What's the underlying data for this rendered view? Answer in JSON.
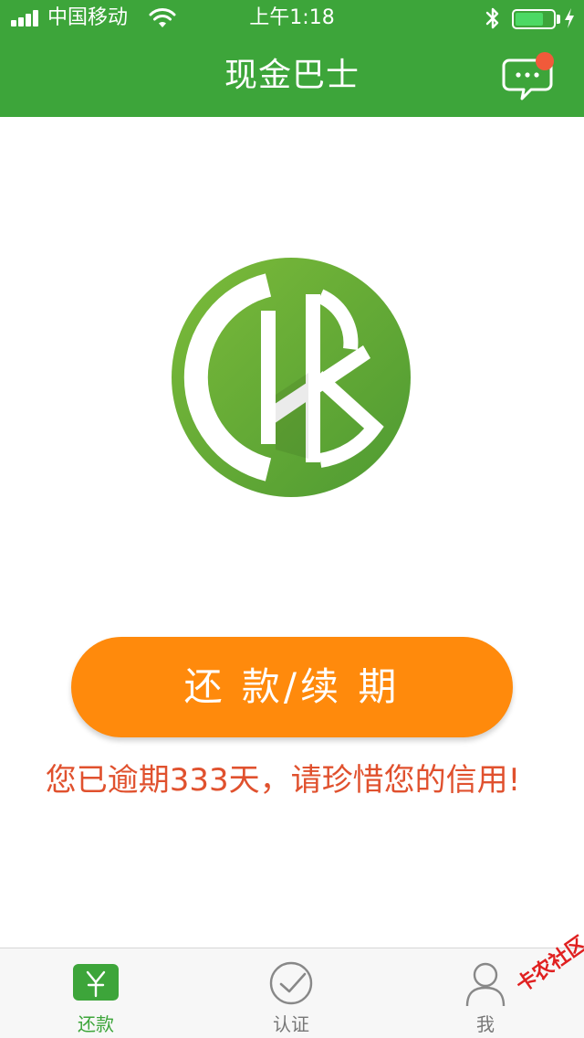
{
  "status_bar": {
    "carrier": "中国移动",
    "time": "上午1:18",
    "battery_level": 0.75,
    "icons": [
      "signal-icon",
      "wifi-icon",
      "bluetooth-icon",
      "battery-icon",
      "charging-icon"
    ]
  },
  "nav": {
    "title": "现金巴士",
    "message_icon": "chat-bubble-icon",
    "has_unread_badge": true
  },
  "main": {
    "logo": "cashbus-logo",
    "repay_button_label": "还 款/续 期",
    "overdue_notice": "您已逾期333天，请珍惜您的信用!"
  },
  "tabbar": {
    "tabs": [
      {
        "label": "还款",
        "icon": "yen-icon",
        "active": true
      },
      {
        "label": "认证",
        "icon": "check-circle-icon",
        "active": false
      },
      {
        "label": "我",
        "icon": "person-icon",
        "active": false
      }
    ]
  },
  "watermark": {
    "text": "卡农社区"
  },
  "colors": {
    "brand_green": "#3da53a",
    "button_orange": "#ff8a0c",
    "warning_red": "#e0512e",
    "badge_red": "#f15a3a"
  }
}
